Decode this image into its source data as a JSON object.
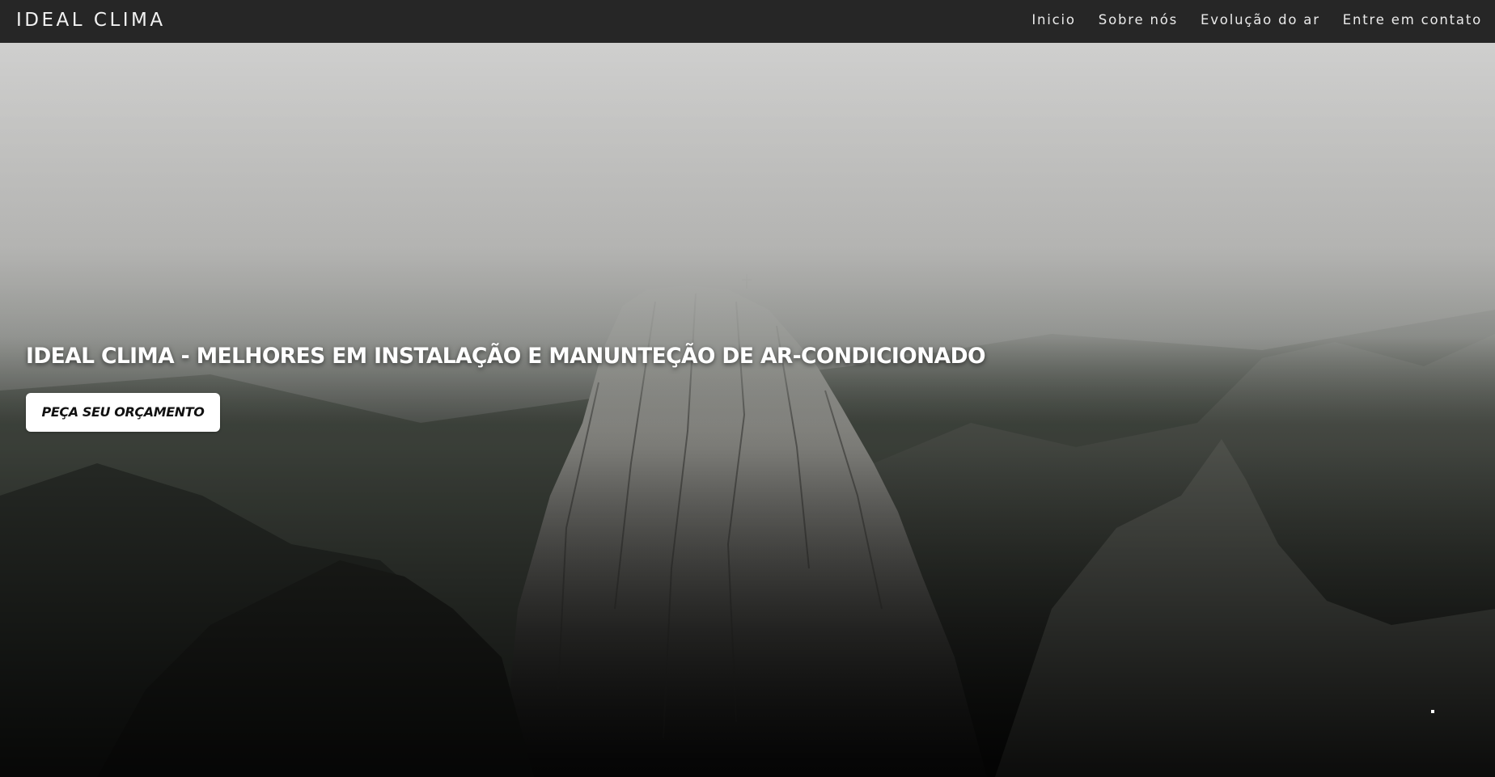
{
  "navbar": {
    "brand": "IDEAL CLIMA",
    "links": [
      {
        "label": "Inicio"
      },
      {
        "label": "Sobre nós"
      },
      {
        "label": "Evolução do ar"
      },
      {
        "label": "Entre em contato"
      }
    ]
  },
  "hero": {
    "background_image": "misty-mountain-peak",
    "title": "IDEAL CLIMA - MELHORES EM INSTALAÇÃO E MANUNTEÇÃO DE AR-CONDICIONADO",
    "cta_label": "PEÇA SEU ORÇAMENTO"
  },
  "colors": {
    "navbar_bg": "#262626",
    "nav_text": "#eaeaea",
    "hero_title": "#ffffff",
    "cta_bg": "#ffffff",
    "cta_text": "#111111"
  }
}
